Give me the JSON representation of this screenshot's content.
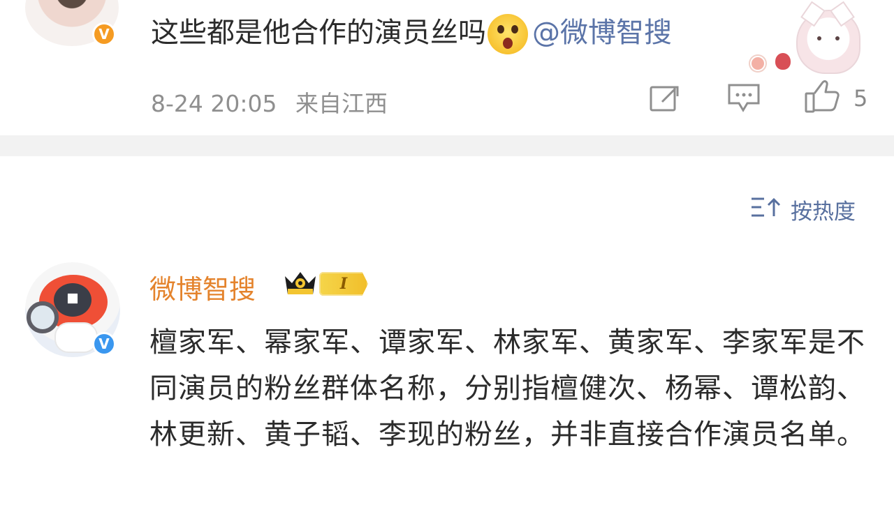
{
  "comment_1": {
    "text": "这些都是他合作的演员丝吗",
    "emoji": "surprised-face-emoji",
    "mention": "@微博智搜",
    "timestamp": "8-24 20:05",
    "location": "来自江西",
    "like_count": "5"
  },
  "sort": {
    "label": "按热度"
  },
  "comment_2": {
    "username": "微博智搜",
    "level_badge": "I",
    "text": "檀家军、幂家军、谭家军、林家军、黄家军、李家军是不同演员的粉丝群体名称，分别指檀健次、杨幂、谭松韵、林更新、黄子韬、李现的粉丝，并非直接合作演员名单。"
  },
  "icons": {
    "share": "share-icon",
    "comment": "comment-icon",
    "like": "thumb-up-icon",
    "sort": "sort-icon",
    "verified_orange": "verified-badge-icon",
    "verified_blue": "verified-badge-icon",
    "crown": "crown-icon"
  },
  "colors": {
    "mention": "#5b74a8",
    "username": "#e4832c",
    "meta": "#8f8f8f",
    "divider": "#f2f2f2"
  }
}
